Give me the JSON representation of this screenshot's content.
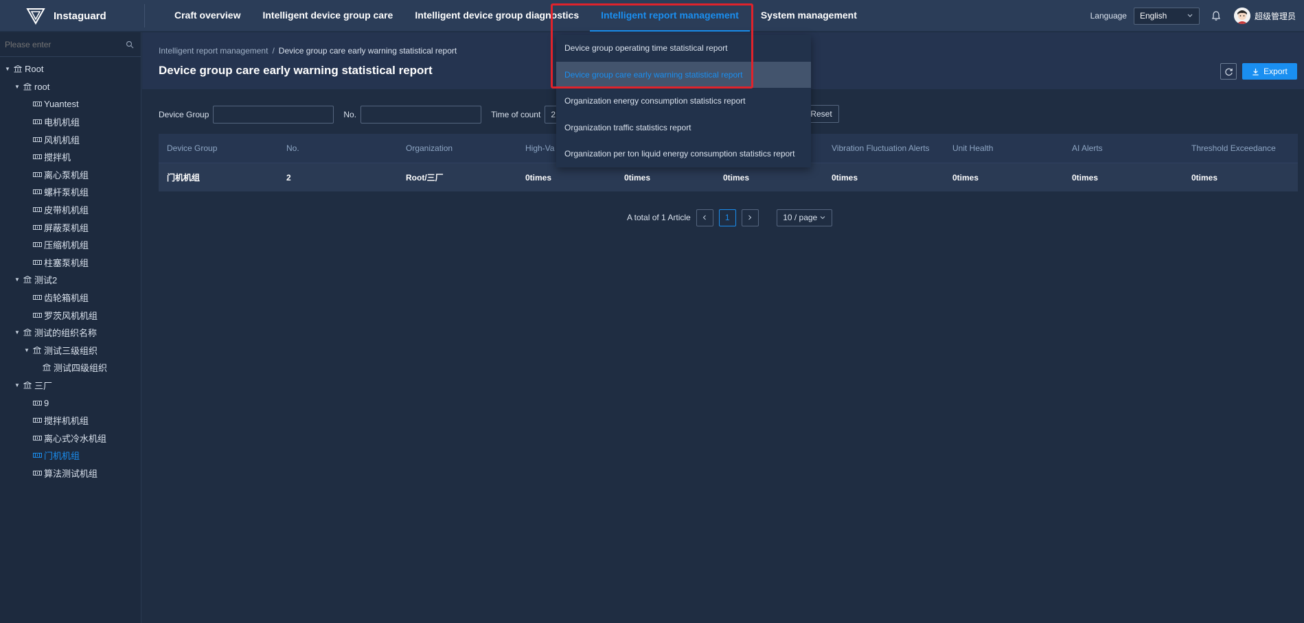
{
  "app": {
    "name": "Instaguard"
  },
  "nav": {
    "items": [
      {
        "label": "Craft overview",
        "active": false
      },
      {
        "label": "Intelligent device group care",
        "active": false
      },
      {
        "label": "Intelligent device group diagnostics",
        "active": false
      },
      {
        "label": "Intelligent report management",
        "active": true
      },
      {
        "label": "System management",
        "active": false
      }
    ]
  },
  "header_right": {
    "language_label": "Language",
    "language_value": "English",
    "username": "超级管理员"
  },
  "dropdown": {
    "items": [
      {
        "label": "Device group operating time statistical report",
        "active": false
      },
      {
        "label": "Device group care early warning statistical report",
        "active": true
      },
      {
        "label": "Organization energy consumption statistics report",
        "active": false
      },
      {
        "label": "Organization traffic statistics report",
        "active": false
      },
      {
        "label": "Organization per ton liquid energy consumption statistics report",
        "active": false
      }
    ]
  },
  "sidebar": {
    "search_placeholder": "Please enter",
    "tree": [
      {
        "label": "Root",
        "level": 0,
        "type": "org",
        "expanded": true
      },
      {
        "label": "root",
        "level": 1,
        "type": "org",
        "expanded": true
      },
      {
        "label": "Yuantest",
        "level": 2,
        "type": "device"
      },
      {
        "label": "电机机组",
        "level": 2,
        "type": "device"
      },
      {
        "label": "风机机组",
        "level": 2,
        "type": "device"
      },
      {
        "label": "搅拌机",
        "level": 2,
        "type": "device"
      },
      {
        "label": "离心泵机组",
        "level": 2,
        "type": "device"
      },
      {
        "label": "螺杆泵机组",
        "level": 2,
        "type": "device"
      },
      {
        "label": "皮带机机组",
        "level": 2,
        "type": "device"
      },
      {
        "label": "屏蔽泵机组",
        "level": 2,
        "type": "device"
      },
      {
        "label": "压缩机机组",
        "level": 2,
        "type": "device"
      },
      {
        "label": "柱塞泵机组",
        "level": 2,
        "type": "device"
      },
      {
        "label": "测试2",
        "level": 1,
        "type": "org",
        "expanded": true
      },
      {
        "label": "齿轮箱机组",
        "level": 2,
        "type": "device"
      },
      {
        "label": "罗茨风机机组",
        "level": 2,
        "type": "device"
      },
      {
        "label": "测试的组织名称",
        "level": 1,
        "type": "org",
        "expanded": true
      },
      {
        "label": "测试三级组织",
        "level": 2,
        "type": "org",
        "expanded": true
      },
      {
        "label": "测试四级组织",
        "level": 3,
        "type": "org"
      },
      {
        "label": "三厂",
        "level": 1,
        "type": "org",
        "expanded": true
      },
      {
        "label": "9",
        "level": 2,
        "type": "device"
      },
      {
        "label": "搅拌机机组",
        "level": 2,
        "type": "device"
      },
      {
        "label": "离心式冷水机组",
        "level": 2,
        "type": "device"
      },
      {
        "label": "门机机组",
        "level": 2,
        "type": "device",
        "selected": true
      },
      {
        "label": "算法测试机组",
        "level": 2,
        "type": "device"
      }
    ]
  },
  "main": {
    "breadcrumb": {
      "parent": "Intelligent report management",
      "separator": "/",
      "current": "Device group care early warning statistical report"
    },
    "title": "Device group care early warning statistical report",
    "export_label": "Export",
    "filter": {
      "device_group_label": "Device Group",
      "no_label": "No.",
      "time_label": "Time of count",
      "time_value_partial": "2",
      "reset_label": "Reset"
    },
    "table": {
      "columns": [
        "Device Group",
        "No.",
        "Organization",
        "High-Va",
        "",
        "",
        "Vibration Fluctuation Alerts",
        "Unit Health",
        "AI Alerts",
        "Threshold Exceedance"
      ],
      "rows": [
        [
          "门机机组",
          "2",
          "Root/三厂",
          "0times",
          "0times",
          "0times",
          "0times",
          "0times",
          "0times",
          "0times"
        ]
      ]
    },
    "pagination": {
      "total_text": "A total of 1 Article",
      "current_page": "1",
      "page_size": "10 / page"
    }
  },
  "colors": {
    "accent": "#1a8ff1",
    "highlight": "#e0232b",
    "background": "#1f2d42"
  }
}
